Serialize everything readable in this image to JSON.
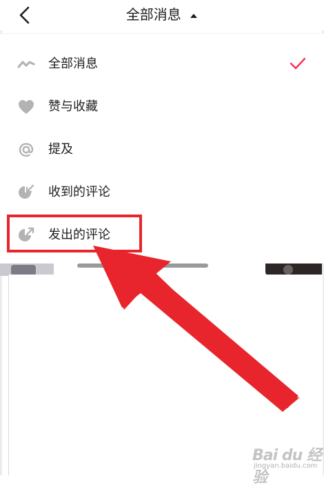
{
  "header": {
    "title": "全部消息",
    "back_icon": "chevron-left-icon",
    "dropdown_icon": "caret-up-icon"
  },
  "menu": {
    "items": [
      {
        "label": "全部消息",
        "icon": "wave-icon",
        "selected": true
      },
      {
        "label": "赞与收藏",
        "icon": "heart-icon",
        "selected": false
      },
      {
        "label": "提及",
        "icon": "at-icon",
        "selected": false
      },
      {
        "label": "收到的评论",
        "icon": "comment-received-icon",
        "selected": false
      },
      {
        "label": "发出的评论",
        "icon": "comment-sent-icon",
        "selected": false
      }
    ]
  },
  "colors": {
    "accent": "#fe2c55",
    "highlight": "#e8252c",
    "icon_gray": "#b3b3b3",
    "text": "#1f1f1f"
  },
  "watermark": {
    "logo": "Bai du 经验",
    "sub": "jingyan.baidu.com"
  }
}
